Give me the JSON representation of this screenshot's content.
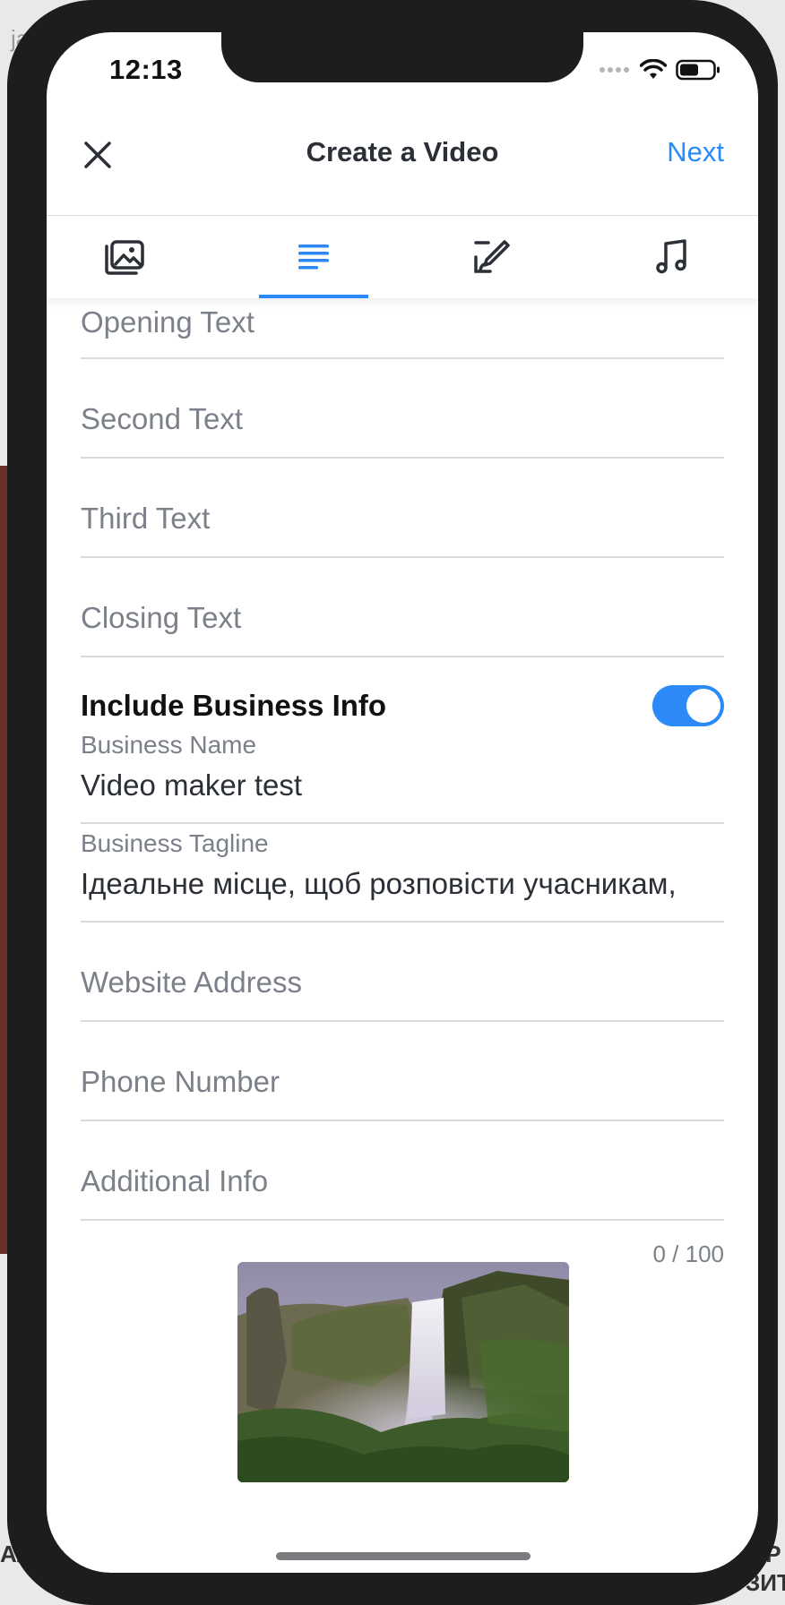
{
  "status_bar": {
    "time": "12:13"
  },
  "nav": {
    "title": "Create a Video",
    "next_label": "Next"
  },
  "tabs": [
    {
      "icon": "image-gallery-icon",
      "selected": false
    },
    {
      "icon": "text-lines-icon",
      "selected": true
    },
    {
      "icon": "brush-edit-icon",
      "selected": false
    },
    {
      "icon": "music-note-icon",
      "selected": false
    }
  ],
  "form": {
    "opening_text_placeholder": "Opening Text",
    "second_text_placeholder": "Second Text",
    "third_text_placeholder": "Third Text",
    "closing_text_placeholder": "Closing Text",
    "business_info_title": "Include Business Info",
    "business_info_enabled": true,
    "business_name_label": "Business Name",
    "business_name_value": "Video maker test",
    "business_tagline_label": "Business Tagline",
    "business_tagline_value": "Ідеальне місце, щоб розповісти учасникам,",
    "website_placeholder": "Website Address",
    "phone_placeholder": "Phone Number",
    "additional_info_placeholder": "Additional Info",
    "char_counter": "0 / 100"
  },
  "background_text": {
    "left": "ja",
    "bottom_left": "АЛ",
    "bottom_right_1": "ЗР",
    "bottom_right_2": "ЗИТ"
  },
  "colors": {
    "accent": "#2b8af7",
    "text_dark": "#2b2f36",
    "placeholder": "#7b8089"
  }
}
